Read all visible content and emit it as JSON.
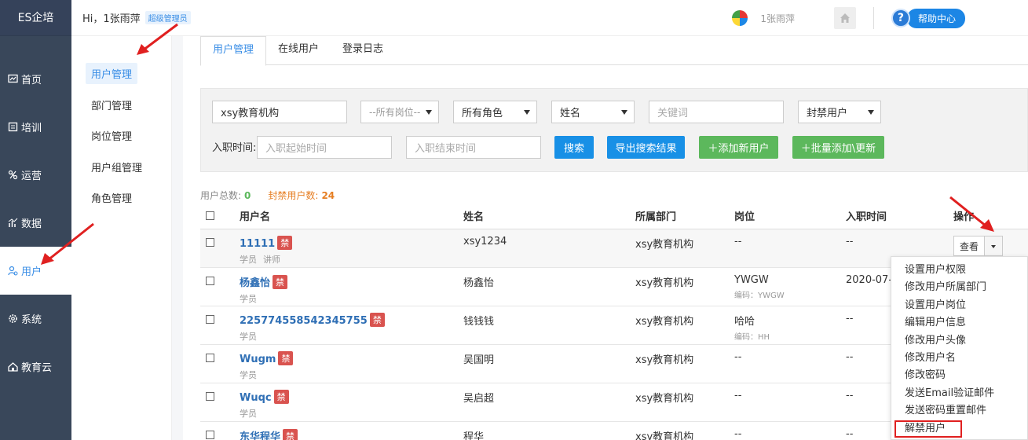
{
  "brand": "ES企培",
  "nav": [
    {
      "label": "首页",
      "icon": "dashboard-icon"
    },
    {
      "label": "培训",
      "icon": "book-icon"
    },
    {
      "label": "运营",
      "icon": "operations-icon"
    },
    {
      "label": "数据",
      "icon": "chart-icon"
    },
    {
      "label": "用户",
      "icon": "users-icon",
      "active": true
    },
    {
      "label": "系统",
      "icon": "gear-icon"
    },
    {
      "label": "教育云",
      "icon": "cloud-icon"
    }
  ],
  "header": {
    "greeting": "Hi，1张雨萍",
    "role": "超级管理员",
    "user": "1张雨萍",
    "help": "帮助中心",
    "help_q": "?"
  },
  "subnav": [
    "用户管理",
    "部门管理",
    "岗位管理",
    "用户组管理",
    "角色管理"
  ],
  "tabs": [
    "用户管理",
    "在线用户",
    "登录日志"
  ],
  "filter": {
    "org": "xsy教育机构",
    "position": "--所有岗位--",
    "role": "所有角色",
    "field": "姓名",
    "keyword_ph": "关键词",
    "banned": "封禁用户",
    "date_label": "入职时间:",
    "start_ph": "入职起始时间",
    "end_ph": "入职结束时间",
    "search": "搜索",
    "export": "导出搜索结果",
    "add": "＋添加新用户",
    "batch": "＋批量添加\\更新"
  },
  "stats": {
    "total_label": "用户总数:",
    "total": "0",
    "banned_label": "封禁用户数:",
    "banned": "24"
  },
  "columns": [
    "用户名",
    "姓名",
    "所属部门",
    "岗位",
    "入职时间",
    "操作"
  ],
  "rows": [
    {
      "username": "11111",
      "badge": "禁",
      "role": "学员",
      "role2": "讲师",
      "name": "xsy1234",
      "dept": "xsy教育机构",
      "post": "--",
      "code": "",
      "date": "--"
    },
    {
      "username": "杨鑫怡",
      "badge": "禁",
      "role": "学员",
      "role2": "",
      "name": "杨鑫怡",
      "dept": "xsy教育机构",
      "post": "YWGW",
      "code": "编码：YWGW",
      "date": "2020-07-1"
    },
    {
      "username": "225774558542345755",
      "badge": "禁",
      "role": "学员",
      "role2": "",
      "name": "钱钱钱",
      "dept": "xsy教育机构",
      "post": "哈哈",
      "code": "编码：HH",
      "date": "--"
    },
    {
      "username": "Wugm",
      "badge": "禁",
      "role": "学员",
      "role2": "",
      "name": "吴国明",
      "dept": "xsy教育机构",
      "post": "--",
      "code": "",
      "date": "--"
    },
    {
      "username": "Wuqc",
      "badge": "禁",
      "role": "学员",
      "role2": "",
      "name": "吴启超",
      "dept": "xsy教育机构",
      "post": "--",
      "code": "",
      "date": "--"
    },
    {
      "username": "东华程华",
      "badge": "禁",
      "role": "",
      "role2": "",
      "name": "程华",
      "dept": "xsy教育机构",
      "post": "--",
      "code": "",
      "date": "--"
    }
  ],
  "view_label": "查看",
  "menu": [
    "设置用户权限",
    "修改用户所属部门",
    "设置用户岗位",
    "编辑用户信息",
    "修改用户头像",
    "修改用户名",
    "修改密码",
    "发送Email验证邮件",
    "发送密码重置邮件",
    "解禁用户"
  ],
  "colors": {
    "sidebar": "#39475a",
    "accent": "#3a8ee6",
    "ban": "#d9534f",
    "annotation": "#e02020"
  }
}
